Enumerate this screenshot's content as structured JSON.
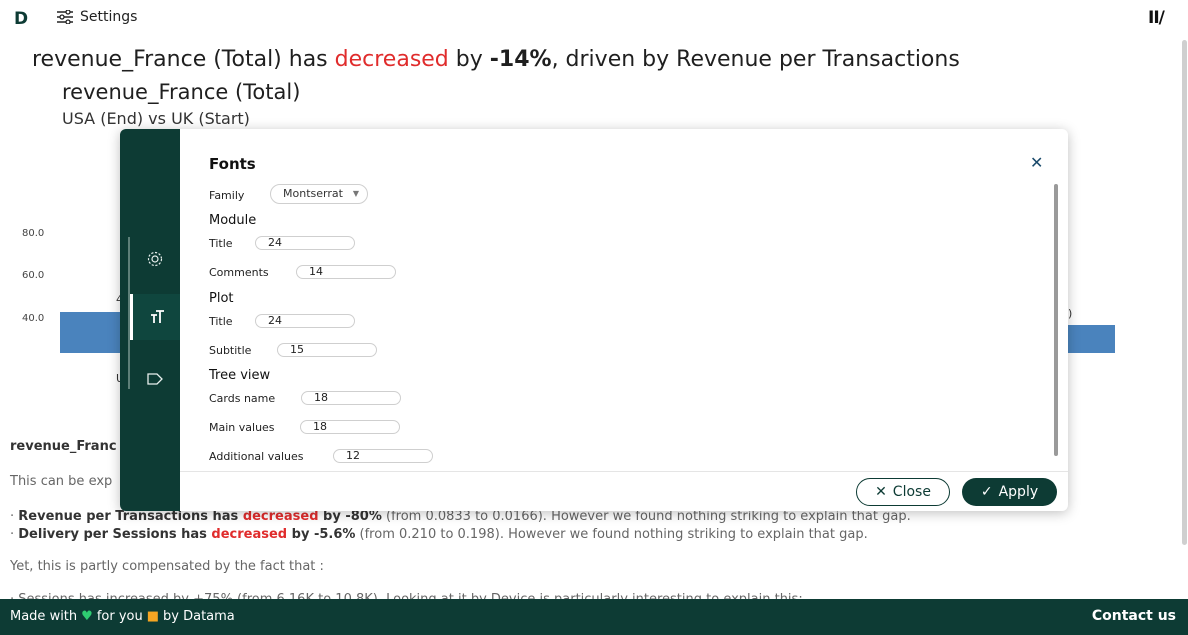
{
  "header": {
    "logo": "D",
    "settings_label": "Settings",
    "brand_mark": "II/"
  },
  "headline": {
    "pre": "revenue_France (Total) has ",
    "trend": "decreased",
    "mid": " by ",
    "pct": "-14%",
    "post": ", driven by Revenue per Transactions"
  },
  "chart": {
    "title": "revenue_France (Total)",
    "subtitle": "USA (End) vs UK (Start)",
    "yticks": [
      "80.0",
      "60.0",
      "40.0"
    ],
    "frag_left_4": "4",
    "frag_left_u": "U",
    "frag_right": ")"
  },
  "chart_data": {
    "type": "bar",
    "title": "revenue_France (Total)",
    "subtitle": "USA (End) vs UK (Start)",
    "y_ticks": [
      80.0,
      60.0,
      40.0
    ]
  },
  "analysis": {
    "section_title": "revenue_Franc",
    "intro": "This can be exp",
    "bullets": [
      {
        "bold": "Revenue per Transactions has ",
        "trend": "decreased",
        "mid": " by -80%",
        "rest": " (from 0.0833 to 0.0166). However we found nothing striking to explain that gap."
      },
      {
        "bold": "Delivery per Sessions has ",
        "trend": "decreased",
        "mid": " by -5.6%",
        "rest": " (from 0.210 to 0.198). However we found nothing striking to explain that gap."
      }
    ],
    "compensated": "Yet, this is partly compensated by the fact that :",
    "cut_line": "· Sessions has increased by +75% (from 6.16K to 10.8K). Looking at it by Device is particularly interesting to explain this:"
  },
  "footer": {
    "made_with": "Made with",
    "for_you": "for you",
    "by": "by Datama",
    "contact": "Contact us"
  },
  "modal": {
    "title": "Fonts",
    "family_label": "Family",
    "family_value": "Montserrat",
    "module_header": "Module",
    "plot_header": "Plot",
    "tree_header": "Tree view",
    "fields": {
      "module_title": {
        "label": "Title",
        "value": "24"
      },
      "module_comments": {
        "label": "Comments",
        "value": "14"
      },
      "plot_title": {
        "label": "Title",
        "value": "24"
      },
      "plot_subtitle": {
        "label": "Subtitle",
        "value": "15"
      },
      "cards_name": {
        "label": "Cards name",
        "value": "18"
      },
      "main_values": {
        "label": "Main values",
        "value": "18"
      },
      "additional_values": {
        "label": "Additional values",
        "value": "12"
      }
    },
    "close_label": "Close",
    "apply_label": "Apply"
  },
  "colors": {
    "brand": "#0d3b34",
    "negative": "#e02c2c",
    "bar": "#4a83bd"
  }
}
